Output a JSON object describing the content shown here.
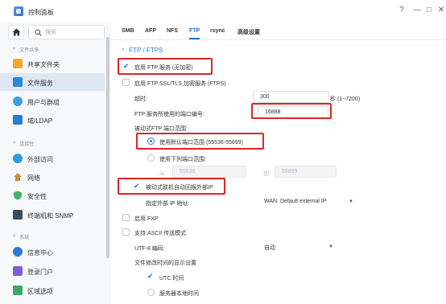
{
  "window": {
    "title": "控制面板",
    "help": "?",
    "minimize": "—",
    "maximize": "□",
    "close": "✕"
  },
  "sidebar": {
    "search_placeholder": "搜索",
    "groups": {
      "file_sharing": "文件共享",
      "connectivity": "连接性",
      "system": "系统"
    },
    "items": {
      "shared_folder": "共享文件夹",
      "file_services": "文件服务",
      "user_group": "用户与群组",
      "domain_ldap": "域/LDAP",
      "external_access": "外部访问",
      "network": "网络",
      "security": "安全性",
      "terminal_snmp": "终端机和 SNMP",
      "info_center": "信息中心",
      "login_portal": "登录门户",
      "regional_options": "区域选项"
    },
    "icon_colors": {
      "shared_folder": "#f0a830",
      "file_services": "#2a8ad8",
      "user_group": "#3aa0e0",
      "domain_ldap": "#2a7ad6",
      "external_access": "#2a9de0",
      "network": "#d9853b",
      "security": "#42b36b",
      "terminal_snmp": "#3d4a5c",
      "info_center": "#2a7ad6",
      "login_portal": "#7b5fd6",
      "regional_options": "#3aa86b"
    }
  },
  "tabs": [
    "SMB",
    "AFP",
    "NFS",
    "FTP",
    "rsync",
    "高级设置"
  ],
  "active_tab": "FTP",
  "section": {
    "title": "FTP / FTPS"
  },
  "form": {
    "enable_ftp": "启用 FTP 服务 (无加密)",
    "enable_ftps": "启用 FTP SSL/TLS 加密服务 (FTPS)",
    "timeout_label": "超时:",
    "timeout_value": "300",
    "timeout_unit": "秒 (1~7200)",
    "port_label": "FTP 服务所使用的端口编号:",
    "port_value": "16888",
    "passive_label": "被动式FTP 端口范围:",
    "use_default_range": "使用默认端口范围 (55536-55899)",
    "use_custom_range": "使用下列端口范围:",
    "from_label": "从:",
    "from_value": "55536",
    "to_label": "到:",
    "to_value": "55899",
    "report_external_ip": "被动式联机自动回报外部IP",
    "external_ip_label": "指定外部 IP 地址:",
    "external_ip_value": "WAN: Default external IP",
    "enable_fxp": "启用 FXP",
    "ascii_mode": "支持 ASCII 传送模式",
    "utf8_label": "UTF-8 编码:",
    "utf8_value": "自动",
    "time_display_label": "文件修改时间的显示设置",
    "utc_time": "UTC 时间",
    "server_time": "服务器本地时间"
  },
  "accent_color": "#1a73c9",
  "highlight_color": "#e02424"
}
